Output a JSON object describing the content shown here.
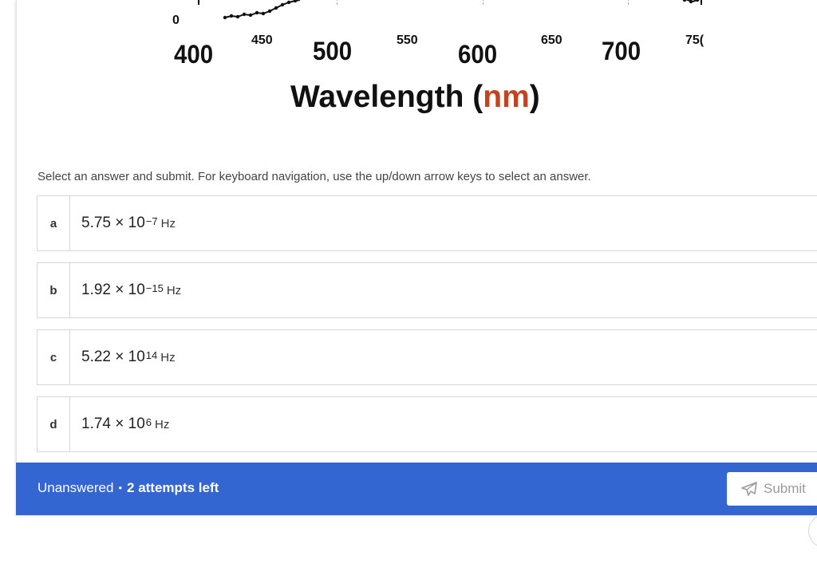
{
  "figure": {
    "zero_label": "0",
    "ticks_big": [
      "400",
      "500",
      "600",
      "700"
    ],
    "ticks_small": [
      "450",
      "550",
      "650",
      "75("
    ],
    "xlabel_main": "Wavelength (",
    "xlabel_unit": "nm",
    "xlabel_close": ")",
    "unit_color": "#c0441f"
  },
  "question": {
    "instructions": "Select an answer and submit. For keyboard navigation, use the up/down arrow keys to select an answer."
  },
  "choices": [
    {
      "letter": "a",
      "mantissa": "5.75 × 10",
      "exponent": "−7",
      "unit": "Hz"
    },
    {
      "letter": "b",
      "mantissa": "1.92 × 10",
      "exponent": "−15",
      "unit": "Hz"
    },
    {
      "letter": "c",
      "mantissa": "5.22 × 10",
      "exponent": "14",
      "unit": "Hz"
    },
    {
      "letter": "d",
      "mantissa": "1.74 × 10",
      "exponent": "6",
      "unit": "Hz"
    }
  ],
  "status": {
    "state": "Unanswered",
    "separator": "•",
    "attempts": "2 attempts left",
    "bar_color": "#3366d1"
  },
  "submit": {
    "label": "Submit",
    "icon": "paper-plane-icon"
  }
}
